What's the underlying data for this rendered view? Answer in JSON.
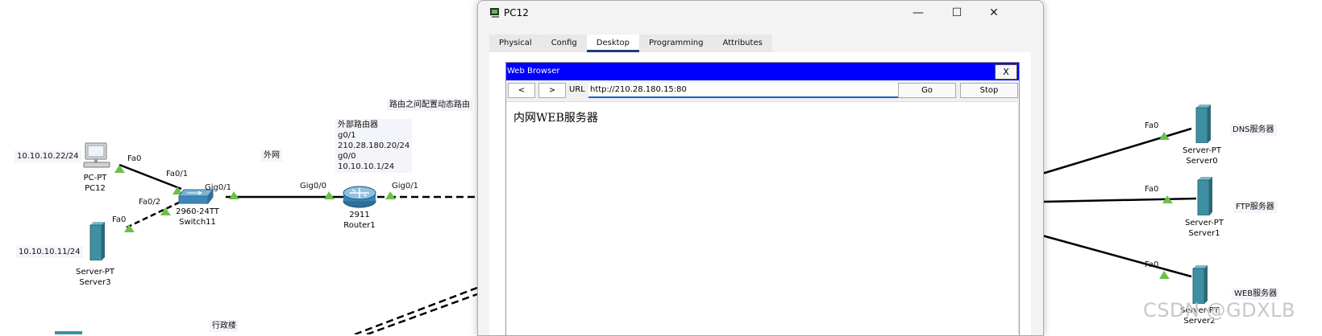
{
  "topology": {
    "ip_pc12": "10.10.10.22/24",
    "ip_server3": "10.10.10.11/24",
    "pc12": {
      "type": "PC-PT",
      "name": "PC12",
      "port": "Fa0"
    },
    "switch11": {
      "type": "2960-24TT",
      "name": "Switch11",
      "ports": {
        "fa01": "Fa0/1",
        "fa02": "Fa0/2",
        "gig01": "Gig0/1"
      }
    },
    "server3": {
      "type": "Server-PT",
      "name": "Server3",
      "port": "Fa0"
    },
    "router1": {
      "type": "2911",
      "name": "Router1",
      "ports": {
        "gig00": "Gig0/0",
        "gig01": "Gig0/1"
      }
    },
    "label_waiwang": "外网",
    "label_dynamic_routing": "路由之间配置动态路由",
    "label_xingzheng": "行政楼",
    "router_note": "外部路由器\ng0/1\n210.28.180.20/24\ng0/0\n10.10.10.1/24",
    "server0": {
      "type": "Server-PT",
      "name": "Server0",
      "port": "Fa0",
      "role": "DNS服务器"
    },
    "server1": {
      "type": "Server-PT",
      "name": "Server1",
      "port": "Fa0",
      "role": "FTP服务器"
    },
    "server2": {
      "type": "Server-PT",
      "name": "Server2",
      "port": "Fa0",
      "role": "WEB服务器"
    }
  },
  "window": {
    "title": "PC12",
    "tabs": [
      "Physical",
      "Config",
      "Desktop",
      "Programming",
      "Attributes"
    ],
    "active_tab": "Desktop",
    "minimize_glyph": "—",
    "maximize_glyph": "☐",
    "close_glyph": "✕"
  },
  "browser": {
    "title": "Web Browser",
    "close_label": "X",
    "back_label": "<",
    "forward_label": ">",
    "url_label": "URL",
    "url_value": "http://210.28.180.15:80",
    "go_label": "Go",
    "stop_label": "Stop",
    "page_text": "内网WEB服务器"
  },
  "watermark": "CSDN @GDXLB",
  "colors": {
    "link_up": "#6cc04a",
    "browser_title_bar": "#0000ff",
    "server_teal": "#3f8fa3",
    "url_underline": "#1e5fc7"
  }
}
